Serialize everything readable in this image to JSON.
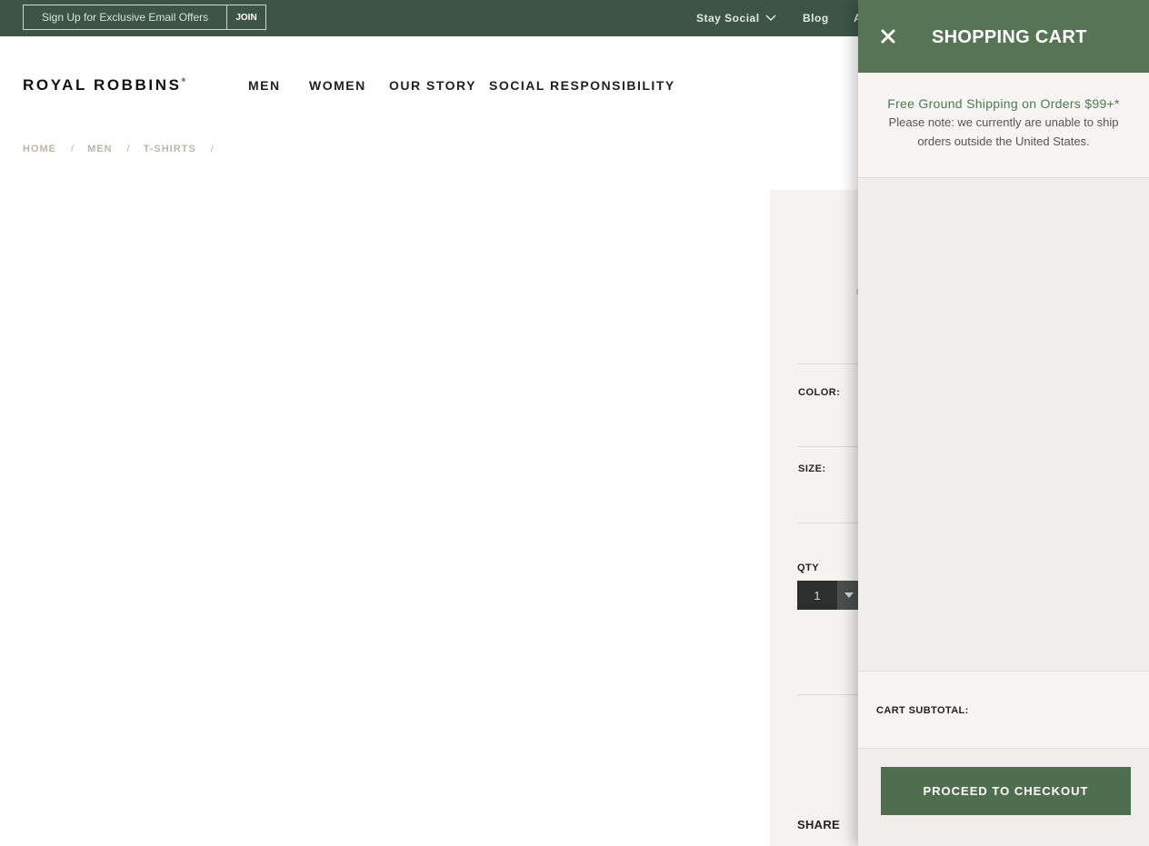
{
  "topbar": {
    "signup_placeholder": "Sign Up for Exclusive Email Offers",
    "join_label": "JOIN",
    "links": [
      {
        "label": "Stay Social",
        "has_dropdown": true
      },
      {
        "label": "Blog"
      },
      {
        "label": "A"
      }
    ]
  },
  "header": {
    "logo": "ROYAL ROBBINS",
    "logo_mark": "®",
    "nav": [
      "MEN",
      "WOMEN",
      "OUR STORY",
      "SOCIAL RESPONSIBILITY"
    ]
  },
  "breadcrumb": {
    "items": [
      "HOME",
      "MEN",
      "T-SHIRTS"
    ],
    "separator": "/"
  },
  "product": {
    "color_label": "COLOR:",
    "size_label": "SIZE:",
    "qty_label": "QTY",
    "qty_value": "1",
    "share_label": "SHARE"
  },
  "cart": {
    "title": "SHOPPING CART",
    "promo": "Free Ground Shipping on Orders $99+*",
    "note": "Please note: we currently are unable to ship orders outside the United States.",
    "subtotal_label": "CART SUBTOTAL:",
    "checkout_label": "PROCEED TO CHECKOUT"
  },
  "colors": {
    "topbar_bg": "#3d5547",
    "cart_header_bg": "#577555",
    "checkout_bg": "#4f6e4d",
    "promo_text": "#4f7a4f",
    "breadcrumb_text": "#bdb6a4"
  }
}
